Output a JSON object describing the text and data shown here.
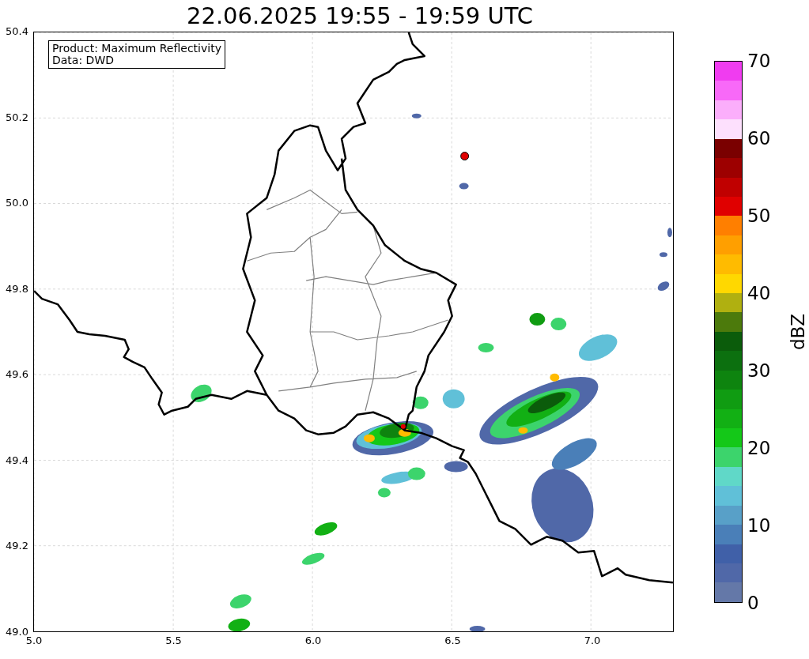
{
  "title": "22.06.2025 19:55 - 19:59 UTC",
  "legend": {
    "lines": [
      "Product: Maximum Reflectivity",
      "Data: DWD"
    ]
  },
  "x_ticks": [
    "5.0",
    "5.5",
    "6.0",
    "6.5",
    "7.0"
  ],
  "y_ticks": [
    "50.4",
    "50.2",
    "50.0",
    "49.8",
    "49.6",
    "49.4",
    "49.2",
    "49.0"
  ],
  "colorbar": {
    "label": "dBZ",
    "ticks": [
      "70",
      "60",
      "50",
      "40",
      "30",
      "20",
      "10",
      "0"
    ],
    "bins": [
      {
        "color": "#f03cf0"
      },
      {
        "color": "#f869f8"
      },
      {
        "color": "#fbaefb"
      },
      {
        "color": "#fde0fd"
      },
      {
        "color": "#7a0000"
      },
      {
        "color": "#9d0000"
      },
      {
        "color": "#c00000"
      },
      {
        "color": "#e00000"
      },
      {
        "color": "#ff7f00"
      },
      {
        "color": "#ff9f00"
      },
      {
        "color": "#ffbb00"
      },
      {
        "color": "#ffd800"
      },
      {
        "color": "#b0b010"
      },
      {
        "color": "#4c7a0c"
      },
      {
        "color": "#0b5c0b"
      },
      {
        "color": "#0c700f"
      },
      {
        "color": "#0e840f"
      },
      {
        "color": "#109c12"
      },
      {
        "color": "#12b014"
      },
      {
        "color": "#14c818"
      },
      {
        "color": "#3cd46c"
      },
      {
        "color": "#60d8c8"
      },
      {
        "color": "#60c0d8"
      },
      {
        "color": "#58a0c8"
      },
      {
        "color": "#4a7fb8"
      },
      {
        "color": "#4060a8"
      },
      {
        "color": "#5068a8"
      },
      {
        "color": "#6478a8"
      }
    ]
  }
}
